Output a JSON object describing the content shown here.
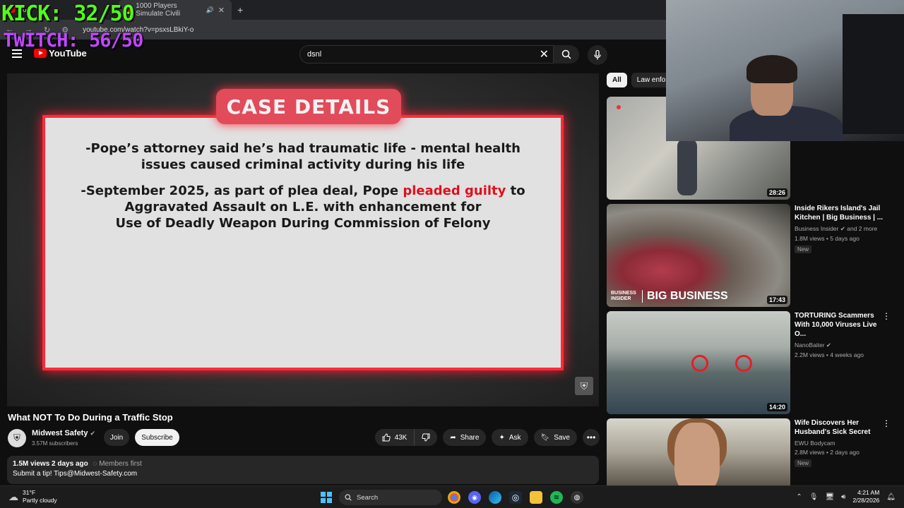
{
  "browser": {
    "tabs": [
      {
        "label": "1000 Players Simulate Civili",
        "active": true
      }
    ],
    "partial_tab_label": "To",
    "url": "youtube.com/watch?v=psxsLBkiY-o"
  },
  "overlay": {
    "kick": "KICK: 32/50",
    "twitch": "TWITCH: 56/50"
  },
  "header": {
    "logo_text": "YouTube",
    "search_value": "dsnl"
  },
  "player": {
    "case_heading": "CASE DETAILS",
    "line1": "-Pope’s attorney said he’s had traumatic life - mental health",
    "line2": "issues caused criminal activity during his life",
    "line3_pre": "-September 2025, as part of plea deal, Pope ",
    "line3_red": "pleaded guilty",
    "line3_post": " to",
    "line4": "Aggravated Assault on L.E. with enhancement for",
    "line5": "Use of Deadly Weapon During Commission of Felony"
  },
  "video": {
    "title": "What NOT To Do During a Traffic Stop",
    "channel": "Midwest Safety",
    "subscribers": "3.57M subscribers",
    "join_label": "Join",
    "subscribe_label": "Subscribe",
    "likes": "43K",
    "share_label": "Share",
    "ask_label": "Ask",
    "save_label": "Save",
    "views_date": "1.5M views  2 days ago",
    "members": "Members first",
    "desc_line": "Submit a tip! Tips@Midwest-Safety.com"
  },
  "chips": [
    "All",
    "Law enfor"
  ],
  "recommendations": [
    {
      "title": "",
      "channel": "",
      "meta": "",
      "badge": "",
      "duration": "28:26"
    },
    {
      "title": "Inside Rikers Island's Jail Kitchen | Big Business | ...",
      "channel": "Business Insider",
      "channel_extra": "and 2 more",
      "meta": "1.8M views • 5 days ago",
      "badge": "New",
      "duration": "17:43",
      "thumb_small": "BUSINESS INSIDER",
      "thumb_big": "BIG BUSINESS"
    },
    {
      "title": "TORTURING Scammers With 10,000 Viruses Live O...",
      "channel": "NanoBaiter",
      "meta": "2.2M views • 4 weeks ago",
      "badge": "",
      "duration": "14:20"
    },
    {
      "title": "Wife Discovers Her Husband's Sick Secret",
      "channel": "EWU Bodycam",
      "meta": "2.8M views • 2 days ago",
      "badge": "New",
      "duration": ""
    }
  ],
  "taskbar": {
    "temp": "31°F",
    "weather": "Partly cloudy",
    "search_label": "Search",
    "time": "4:21 AM",
    "date": "2/28/2026",
    "notif_count": "2"
  },
  "colors": {
    "kick": "#53fc18",
    "twitch": "#c147ff",
    "case_red": "#ff2a3a",
    "yt_red": "#ff0000"
  }
}
